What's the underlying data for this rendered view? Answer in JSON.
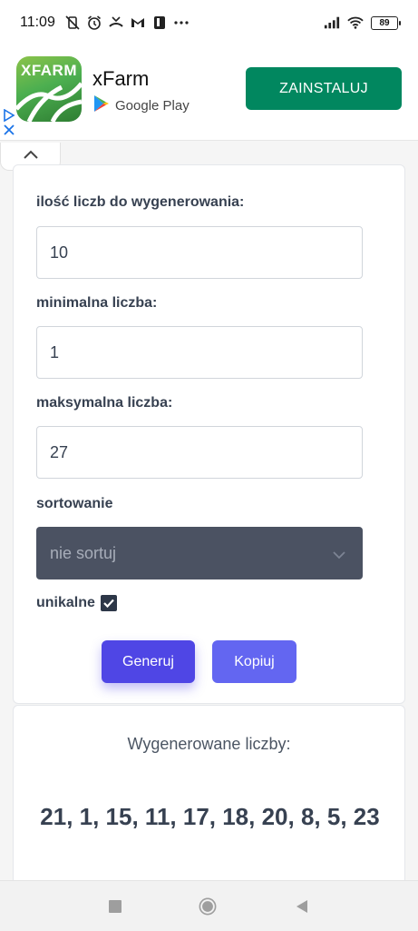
{
  "status_bar": {
    "time": "11:09",
    "battery": "89"
  },
  "ad": {
    "app_icon_text": "XFARM",
    "app_name": "xFarm",
    "store_label": "Google Play",
    "install_label": "ZAINSTALUJ"
  },
  "form": {
    "count_label": "ilość liczb do wygenerowania:",
    "count_value": "10",
    "min_label": "minimalna liczba:",
    "min_value": "1",
    "max_label": "maksymalna liczba:",
    "max_value": "27",
    "sort_label": "sortowanie",
    "sort_selected": "nie sortuj",
    "unique_label": "unikalne",
    "unique_checked": true,
    "generate_label": "Generuj",
    "copy_label": "Kopiuj"
  },
  "result": {
    "heading": "Wygenerowane liczby:",
    "numbers": "21, 1, 15, 11, 17, 18, 20, 8, 5, 23"
  },
  "colors": {
    "primary": "#4f46e5",
    "secondary": "#6366f1",
    "select_bg": "#4b5262",
    "install_green": "#01875f"
  }
}
